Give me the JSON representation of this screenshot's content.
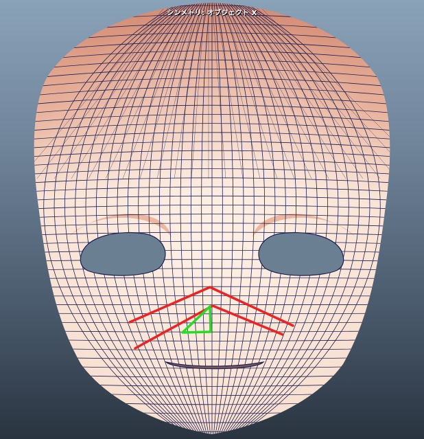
{
  "viewport": {
    "status_text": "シンメトリ: オブジェクト X"
  },
  "colors": {
    "bg_top": "#8aa2b8",
    "bg_bottom": "#2a3440",
    "skin": "#f6d8c6",
    "skin_top": "#d8907a",
    "wire": "#1c1f52",
    "annotation_red": "#ee2222",
    "annotation_green": "#22dd22"
  },
  "annotations": [
    {
      "type": "red-stroke",
      "label": "nose-left-line"
    },
    {
      "type": "red-stroke",
      "label": "nose-right-line"
    },
    {
      "type": "green-triangle",
      "label": "nostril-triangle"
    }
  ]
}
